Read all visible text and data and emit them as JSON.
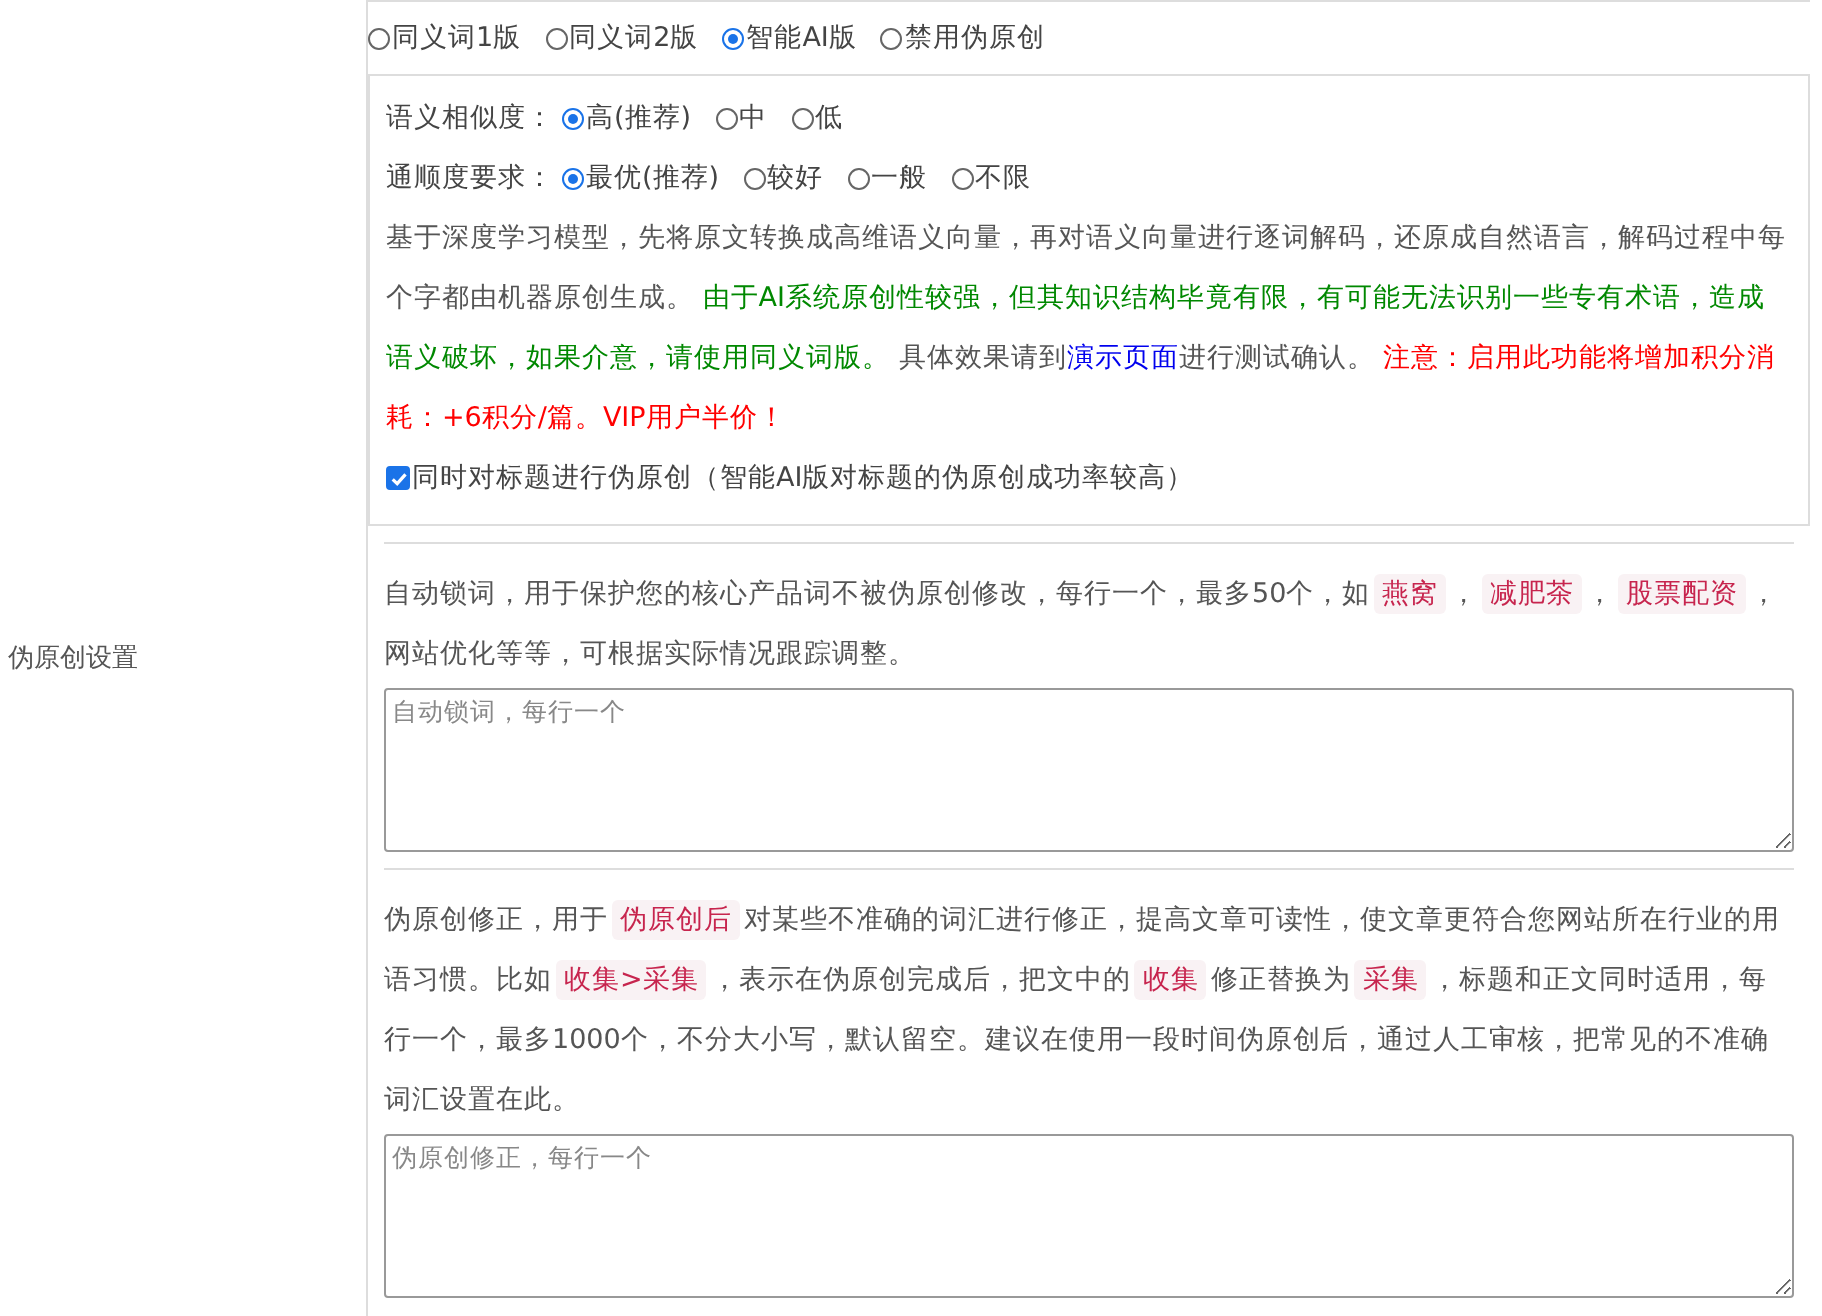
{
  "label": "伪原创设置",
  "modes": [
    {
      "label": "同义词1版",
      "selected": false
    },
    {
      "label": "同义词2版",
      "selected": false
    },
    {
      "label": "智能AI版",
      "selected": true
    },
    {
      "label": "禁用伪原创",
      "selected": false
    }
  ],
  "ai_options": {
    "settings": [
      {
        "label": "语义相似度：",
        "options": [
          {
            "label": "高(推荐)",
            "selected": true
          },
          {
            "label": "中",
            "selected": false
          },
          {
            "label": "低",
            "selected": false
          }
        ]
      },
      {
        "label": "通顺度要求：",
        "options": [
          {
            "label": "最优(推荐)",
            "selected": true
          },
          {
            "label": "较好",
            "selected": false
          },
          {
            "label": "一般",
            "selected": false
          },
          {
            "label": "不限",
            "selected": false
          }
        ]
      }
    ],
    "description": [
      {
        "kind": "plain",
        "text": "基于深度学习模型，先将原文转换成高维语义向量，再对语义向量进行逐词解码，还原成自然语言，解码过程中每个字都由机器原创生成。 "
      },
      {
        "kind": "notice",
        "text": "由于AI系统原创性较强，但其知识结构毕竟有限，有可能无法识别一些专有术语，造成语义破坏，如果介意，请使用同义词版。"
      },
      {
        "kind": "plain",
        "text": " 具体效果请到"
      },
      {
        "kind": "link",
        "text": "演示页面"
      },
      {
        "kind": "plain",
        "text": "进行测试确认。 "
      },
      {
        "kind": "warning",
        "text": "注意：启用此功能将增加积分消耗：+6积分/篇。VIP用户半价！"
      }
    ],
    "title_checkbox": {
      "label": "同时对标题进行伪原创（智能AI版对标题的伪原创成功率较高）",
      "checked": true
    }
  },
  "lock_words": {
    "segments": [
      {
        "kind": "text",
        "text": "自动锁词，用于保护您的核心产品词不被伪原创修改，每行一个，最多50个，如"
      },
      {
        "kind": "tag",
        "text": "燕窝"
      },
      {
        "kind": "text",
        "text": "，"
      },
      {
        "kind": "tag",
        "text": "减肥茶"
      },
      {
        "kind": "text",
        "text": "，"
      },
      {
        "kind": "tag",
        "text": "股票配资"
      },
      {
        "kind": "text",
        "text": "，网站优化等等，可根据实际情况跟踪调整。"
      }
    ],
    "placeholder": "自动锁词，每行一个"
  },
  "correction": {
    "segments": [
      {
        "kind": "text",
        "text": "伪原创修正，用于"
      },
      {
        "kind": "tag",
        "text": "伪原创后"
      },
      {
        "kind": "text",
        "text": "对某些不准确的词汇进行修正，提高文章可读性，使文章更符合您网站所在行业的用语习惯。比如"
      },
      {
        "kind": "tag",
        "text": "收集>采集"
      },
      {
        "kind": "text",
        "text": "，表示在伪原创完成后，把文中的"
      },
      {
        "kind": "tag",
        "text": "收集"
      },
      {
        "kind": "text",
        "text": "修正替换为"
      },
      {
        "kind": "tag",
        "text": "采集"
      },
      {
        "kind": "text",
        "text": "，标题和正文同时适用，每行一个，最多1000个，不分大小写，默认留空。建议在使用一段时间伪原创后，通过人工审核，把常见的不准确词汇设置在此。"
      }
    ],
    "placeholder": "伪原创修正，每行一个"
  }
}
